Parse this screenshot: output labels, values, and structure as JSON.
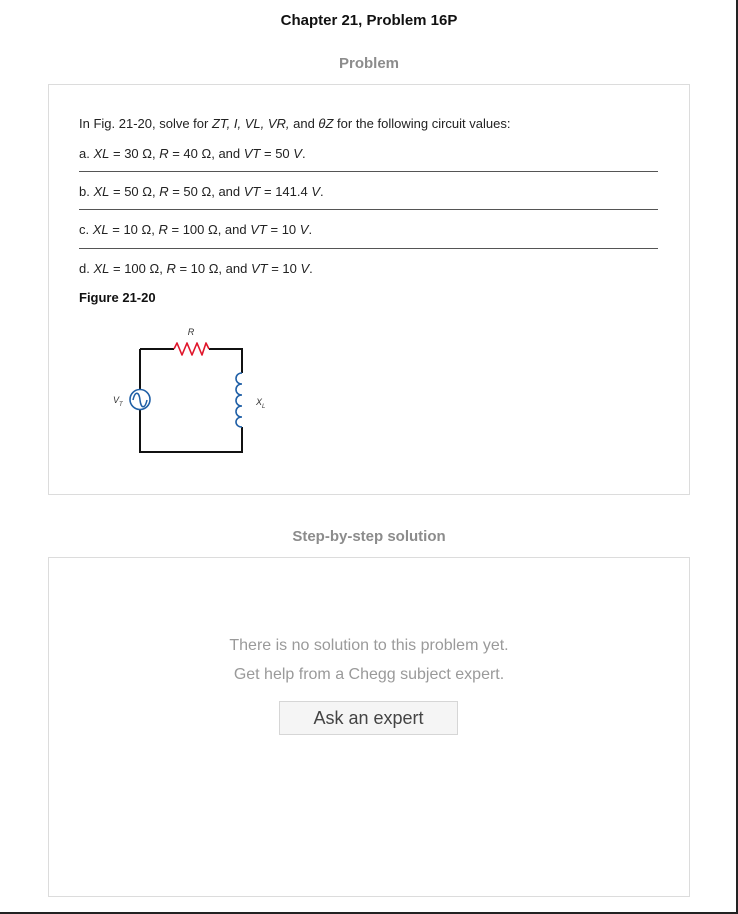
{
  "page": {
    "title": "Chapter 21, Problem 16P"
  },
  "problem": {
    "heading": "Problem",
    "intro": {
      "p1": "In Fig. 21-20, solve for ",
      "zt": "ZT, I, VL, VR,",
      "p2": " and ",
      "thz": "θZ",
      "p3": " for the following circuit values:"
    },
    "parts": [
      {
        "prefix": "a. ",
        "xl": "XL",
        "xl_val": " = 30 Ω, ",
        "r": "R",
        "r_val": " = 40 Ω, and ",
        "vt": "VT",
        "vt_val": " = 50 ",
        "unit": "V",
        "end": "."
      },
      {
        "prefix": "b. ",
        "xl": "XL",
        "xl_val": " = 50 Ω, ",
        "r": "R",
        "r_val": " = 50 Ω, and ",
        "vt": "VT",
        "vt_val": " = 141.4 ",
        "unit": "V",
        "end": "."
      },
      {
        "prefix": "c. ",
        "xl": "XL",
        "xl_val": " = 10 Ω, ",
        "r": "R",
        "r_val": " = 100 Ω, and ",
        "vt": "VT",
        "vt_val": " = 10 ",
        "unit": "V",
        "end": "."
      },
      {
        "prefix": "d. ",
        "xl": "XL",
        "xl_val": " = 100 Ω, ",
        "r": "R",
        "r_val": " = 10 Ω, and ",
        "vt": "VT",
        "vt_val": " = 10 ",
        "unit": "V",
        "end": "."
      }
    ],
    "figure_label": "Figure 21-20",
    "figure": {
      "resistor_label": "R",
      "source_label_main": "V",
      "source_label_sub": "T",
      "inductor_label_main": "X",
      "inductor_label_sub": "L",
      "colors": {
        "resistor": "#e0162b",
        "coil": "#1f5fa6",
        "wire": "#111111"
      }
    }
  },
  "solution": {
    "heading": "Step-by-step solution",
    "message_line1": "There is no solution to this problem yet.",
    "message_line2": "Get help from a Chegg subject expert.",
    "ask_button": "Ask an expert"
  }
}
